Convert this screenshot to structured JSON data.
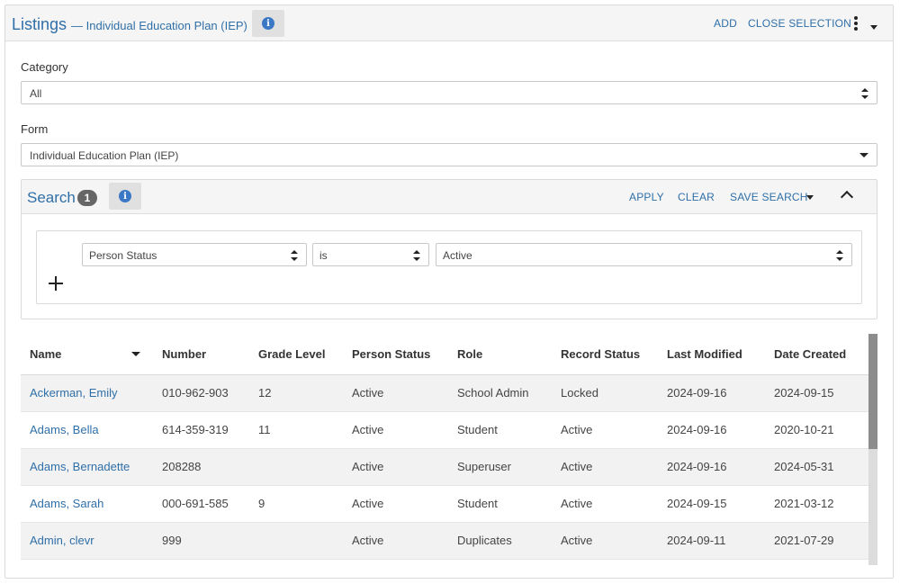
{
  "header": {
    "title": "Listings",
    "subtitle": "— Individual Education Plan (IEP)",
    "add_label": "ADD",
    "close_label": "CLOSE SELECTION",
    "info_glyph": "i"
  },
  "category": {
    "label": "Category",
    "value": "All"
  },
  "form": {
    "label": "Form",
    "value": "Individual Education Plan (IEP)"
  },
  "search": {
    "title": "Search",
    "badge": "1",
    "apply_label": "APPLY",
    "clear_label": "CLEAR",
    "save_label": "SAVE SEARCH",
    "criteria": {
      "field": "Person Status",
      "operator": "is",
      "value": "Active"
    }
  },
  "table": {
    "columns": [
      "Name",
      "Number",
      "Grade Level",
      "Person Status",
      "Role",
      "Record Status",
      "Last Modified",
      "Date Created"
    ],
    "rows": [
      [
        "Ackerman, Emily",
        "010-962-903",
        "12",
        "Active",
        "School Admin",
        "Locked",
        "2024-09-16",
        "2024-09-15"
      ],
      [
        "Adams, Bella",
        "614-359-319",
        "11",
        "Active",
        "Student",
        "Active",
        "2024-09-16",
        "2020-10-21"
      ],
      [
        "Adams, Bernadette",
        "208288",
        "",
        "Active",
        "Superuser",
        "Active",
        "2024-09-16",
        "2024-05-31"
      ],
      [
        "Adams, Sarah",
        "000-691-585",
        "9",
        "Active",
        "Student",
        "Active",
        "2024-09-15",
        "2021-03-12"
      ],
      [
        "Admin, clevr",
        "999",
        "",
        "Active",
        "Duplicates",
        "Active",
        "2024-09-11",
        "2021-07-29"
      ]
    ]
  },
  "colors": {
    "link": "#2f6fa8",
    "header_bg": "#f5f5f5",
    "stripe": "#f2f2f2",
    "info": "#3a78c6"
  }
}
